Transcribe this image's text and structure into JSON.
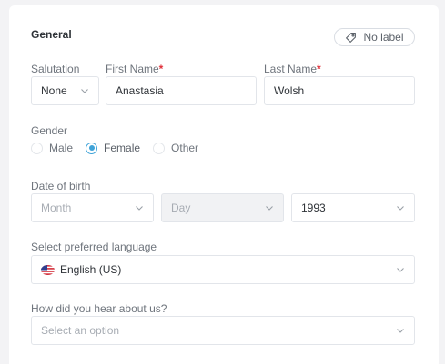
{
  "section": {
    "title": "General"
  },
  "label_chip": {
    "text": "No label",
    "icon": "tag-icon"
  },
  "salutation": {
    "label": "Salutation",
    "value": "None"
  },
  "first_name": {
    "label": "First Name",
    "required_mark": "*",
    "value": "Anastasia"
  },
  "last_name": {
    "label": "Last Name",
    "required_mark": "*",
    "value": "Wolsh"
  },
  "gender": {
    "label": "Gender",
    "options": [
      "Male",
      "Female",
      "Other"
    ],
    "selected": "Female"
  },
  "dob": {
    "label": "Date of birth",
    "month_placeholder": "Month",
    "day_placeholder": "Day",
    "year_value": "1993"
  },
  "language": {
    "label": "Select preferred language",
    "value": "English (US)",
    "flag_icon": "us-flag-icon"
  },
  "referral": {
    "label": "How did you hear about us?",
    "placeholder": "Select an option"
  },
  "colors": {
    "accent": "#3fa3d8",
    "required": "#e0303a"
  }
}
